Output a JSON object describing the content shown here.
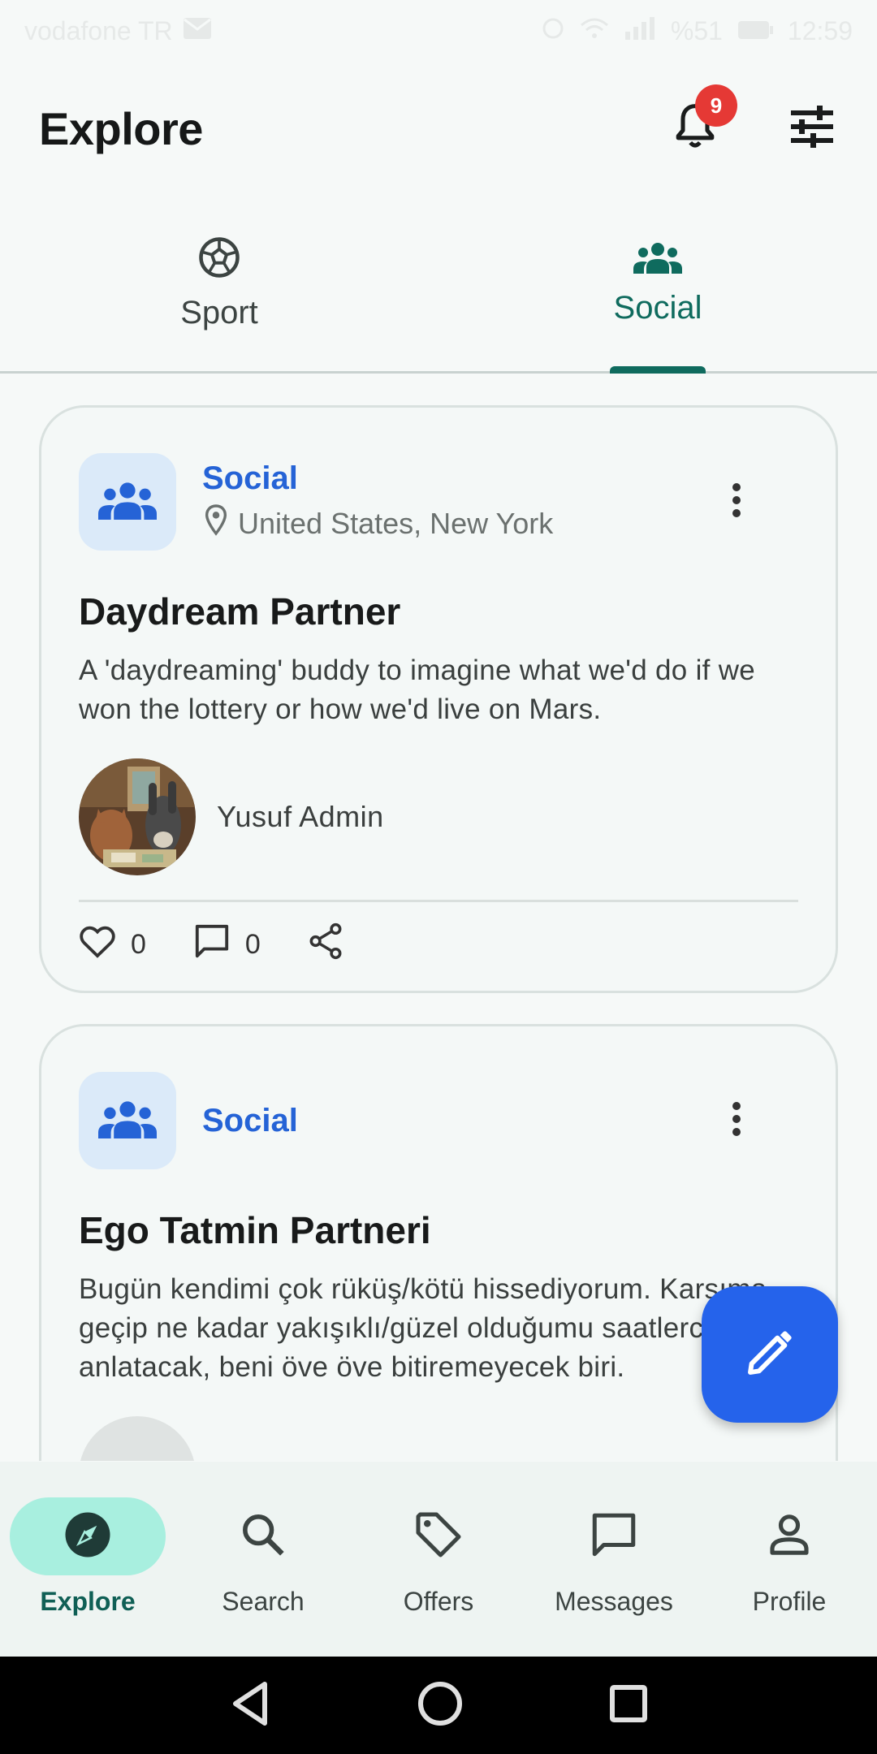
{
  "status_bar": {
    "carrier": "vodafone TR",
    "battery": "%51",
    "time": "12:59"
  },
  "header": {
    "title": "Explore",
    "notification_count": "9"
  },
  "tabs": [
    {
      "label": "Sport",
      "icon": "soccer-ball-icon",
      "active": false
    },
    {
      "label": "Social",
      "icon": "groups-icon",
      "active": true
    }
  ],
  "posts": [
    {
      "category": "Social",
      "location": "United States, New York",
      "title": "Daydream Partner",
      "description": "A 'daydreaming' buddy to imagine what we'd do if we won the lottery or how we'd live on Mars.",
      "author": "Yusuf Admin",
      "likes": "0",
      "comments": "0"
    },
    {
      "category": "Social",
      "title": "Ego Tatmin Partneri",
      "description": "Bugün kendimi çok rüküş/kötü hissediyorum. Karşıma geçip ne kadar yakışıklı/güzel olduğumu saatlerce anlatacak, beni öve öve bitiremeyecek biri."
    }
  ],
  "bottom_nav": [
    {
      "label": "Explore",
      "icon": "compass-icon",
      "active": true
    },
    {
      "label": "Search",
      "icon": "search-icon"
    },
    {
      "label": "Offers",
      "icon": "tag-icon"
    },
    {
      "label": "Messages",
      "icon": "message-icon"
    },
    {
      "label": "Profile",
      "icon": "person-icon"
    }
  ],
  "colors": {
    "accent": "#0f6b5e",
    "category": "#2563d6",
    "fab": "#2563eb",
    "badge": "#e53935",
    "nav_active_bg": "#a8efdf"
  }
}
